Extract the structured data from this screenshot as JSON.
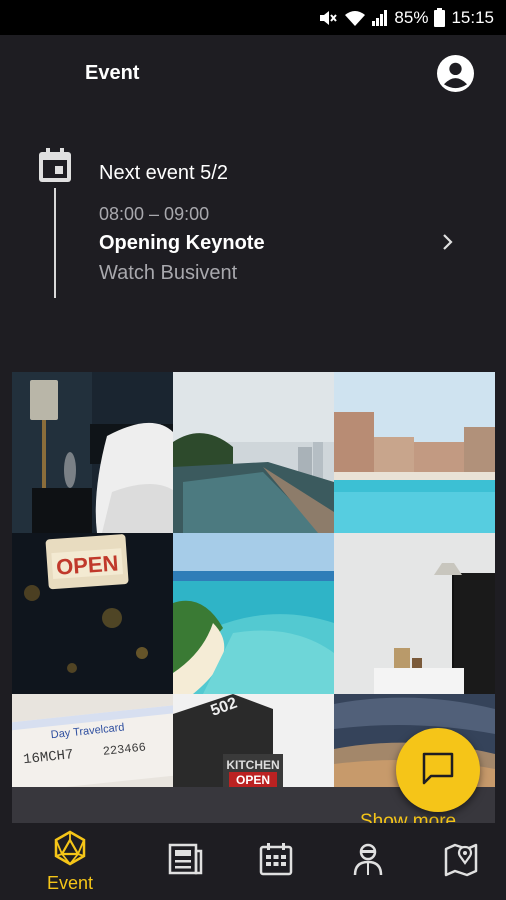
{
  "status_bar": {
    "battery": "85%",
    "time": "15:15"
  },
  "app_bar": {
    "title": "Event"
  },
  "next_event": {
    "label": "Next event 5/2",
    "time": "08:00 – 09:00",
    "title": "Opening Keynote",
    "subtitle": "Watch Busivent"
  },
  "gallery": {
    "show_more": "Show more",
    "photos": [
      "bedroom-lamp",
      "infinity-pool",
      "resort-pool",
      "open-sign",
      "tropical-beach",
      "white-room",
      "travelcard",
      "kitchen-open-sign",
      "sunset-sky"
    ]
  },
  "bottom_nav": {
    "items": [
      {
        "label": "Event",
        "icon": "event-icon",
        "active": true
      },
      {
        "label": "",
        "icon": "news-icon"
      },
      {
        "label": "",
        "icon": "calendar-icon"
      },
      {
        "label": "",
        "icon": "people-icon"
      },
      {
        "label": "",
        "icon": "map-icon"
      }
    ]
  },
  "colors": {
    "accent": "#f5c518",
    "background": "#1e1d22"
  }
}
